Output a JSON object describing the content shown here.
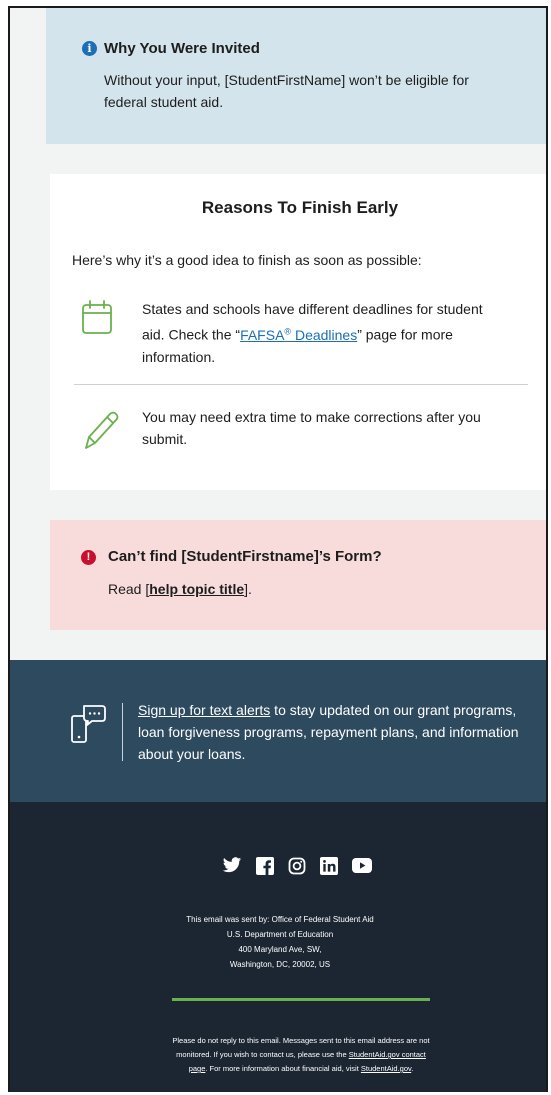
{
  "invited": {
    "title": "Why You Were Invited",
    "body": "Without your input, [StudentFirstName] won’t be eligible for federal student aid."
  },
  "reasons": {
    "title": "Reasons To Finish Early",
    "intro": "Here’s why it’s a good idea to finish as soon as possible:",
    "item1": {
      "before": "States and schools have different deadlines for student aid. Check the “",
      "link_main": "FAFSA",
      "link_sup": "®",
      "link_rest": " Deadlines",
      "after": "” page for more information."
    },
    "item2": "You may need extra time to make corrections after you submit."
  },
  "error": {
    "title": "Can’t find [StudentFirstname]’s Form?",
    "read_label": "Read ",
    "link_open": "[",
    "link_text": "help topic title",
    "link_close": "]."
  },
  "alerts": {
    "link_text": "Sign up for text alerts",
    "rest": " to stay updated on our grant programs, loan forgiveness programs, repayment plans, and information about your loans."
  },
  "footer": {
    "address_lines": [
      "This email was sent by: Office of Federal Student Aid",
      "U.S. Department of Education",
      "400 Maryland Ave, SW,",
      "Washington, DC, 20002, US"
    ],
    "disclaimer": {
      "part1": "Please do not reply to this email. Messages sent to this email address are not monitored. If you wish to contact us, please use the ",
      "link1": "StudentAid.gov contact page",
      "part2": ". For more information about financial aid, visit ",
      "link2": "StudentAid.gov",
      "part3": "."
    },
    "social": [
      "twitter-icon",
      "facebook-icon",
      "instagram-icon",
      "linkedin-icon",
      "youtube-icon"
    ]
  },
  "colors": {
    "info_blue": "#1a6fb5",
    "invited_bg": "#d3e4ec",
    "error_red": "#c8102e",
    "error_bg": "#f8dcdc",
    "icon_green": "#6ab04c",
    "alerts_bg": "#2e4a5e",
    "footer_bg": "#1b2632"
  }
}
